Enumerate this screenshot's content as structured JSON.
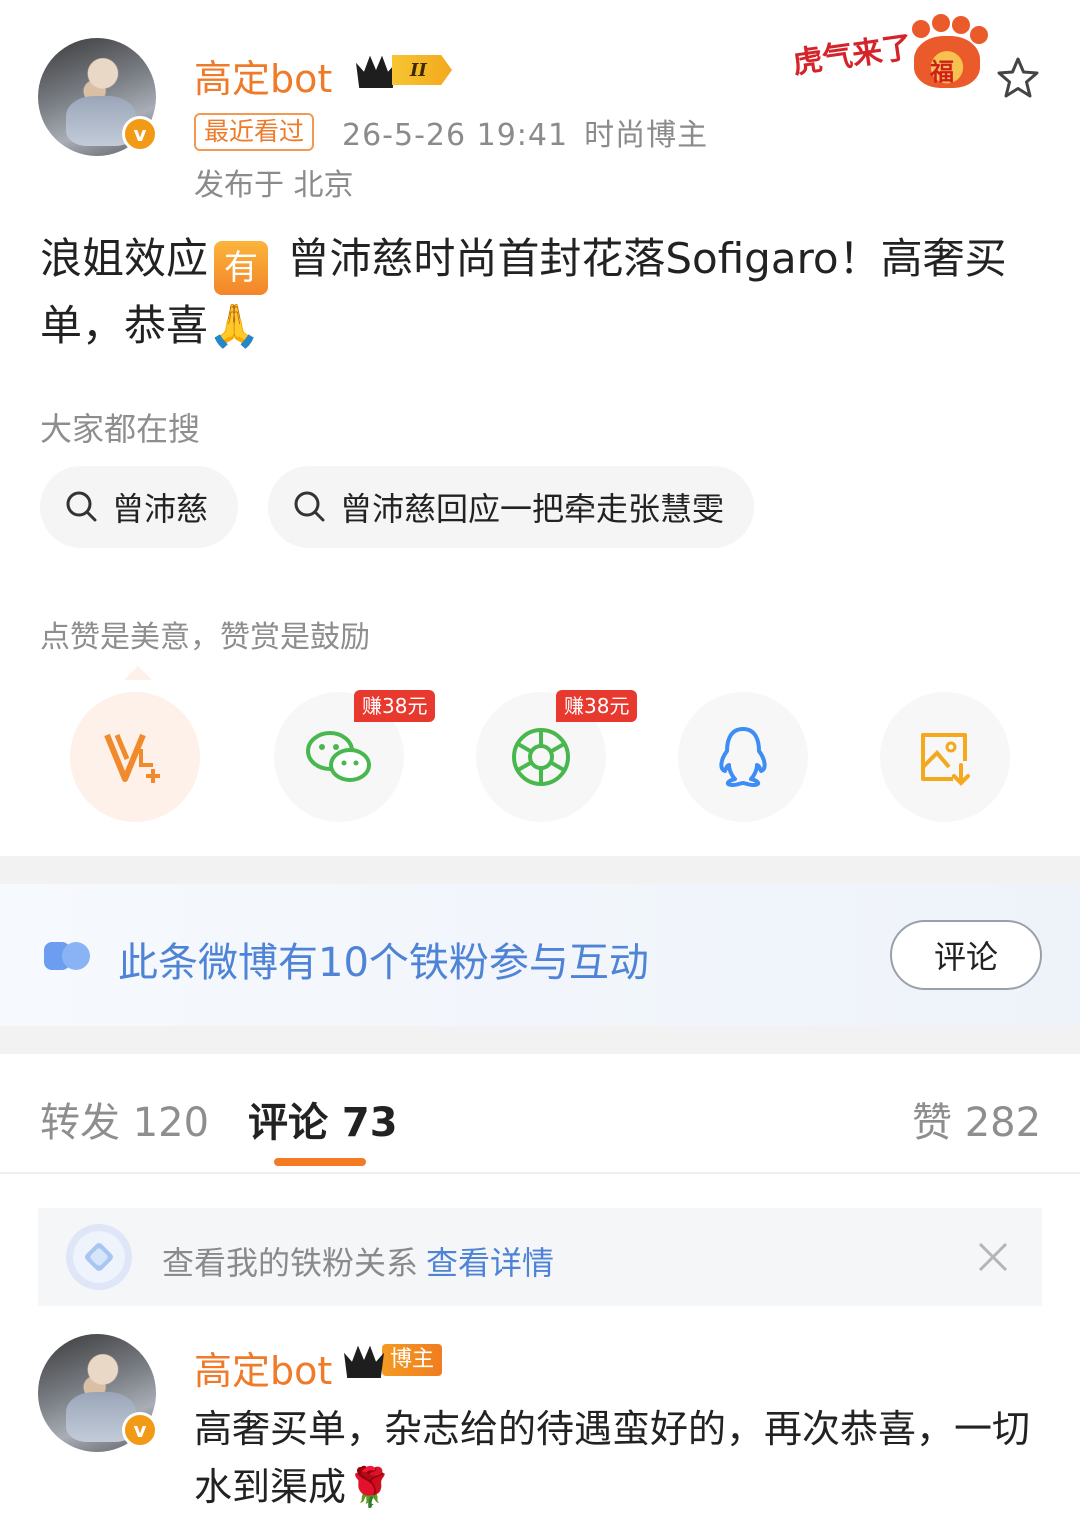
{
  "post": {
    "author": "高定bot",
    "level_badge": "II",
    "recent_tag": "最近看过",
    "timestamp": "26-5-26 19:41",
    "category": "时尚博主",
    "location": "发布于 北京",
    "activity_badge": "虎气来了",
    "activity_badge_char": "福",
    "text_before": "浪姐效应",
    "you_tag": "有",
    "text_after": " 曾沛慈时尚首封花落Sofigaro！高奢买单，恭喜",
    "emoji": "🙏"
  },
  "search": {
    "label": "大家都在搜",
    "chips": [
      "曾沛慈",
      "曾沛慈回应一把牵走张慧雯"
    ]
  },
  "reward": {
    "label": "点赞是美意，赞赏是鼓励",
    "earn_tag_1": "赚38元",
    "earn_tag_2": "赚38元",
    "share_icons": [
      "vip-reward-icon",
      "wechat-icon",
      "moments-icon",
      "qq-icon",
      "save-image-icon"
    ]
  },
  "fans": {
    "text": "此条微博有10个铁粉参与互动",
    "button": "评论"
  },
  "tabs": {
    "repost": "转发 120",
    "comment": "评论 73",
    "like": "赞 282"
  },
  "ironfan": {
    "text": "查看我的铁粉关系",
    "link": "查看详情"
  },
  "comment": {
    "author": "高定bot",
    "badge": "博主",
    "text": "高奢买单，杂志给的待遇蛮好的，再次恭喜，一切水到渠成",
    "emoji": "🌹"
  },
  "colors": {
    "accent": "#ef7a29",
    "link_blue": "#4e83d6",
    "tab_underline": "#f57a24",
    "earn_red": "#e8392f"
  }
}
